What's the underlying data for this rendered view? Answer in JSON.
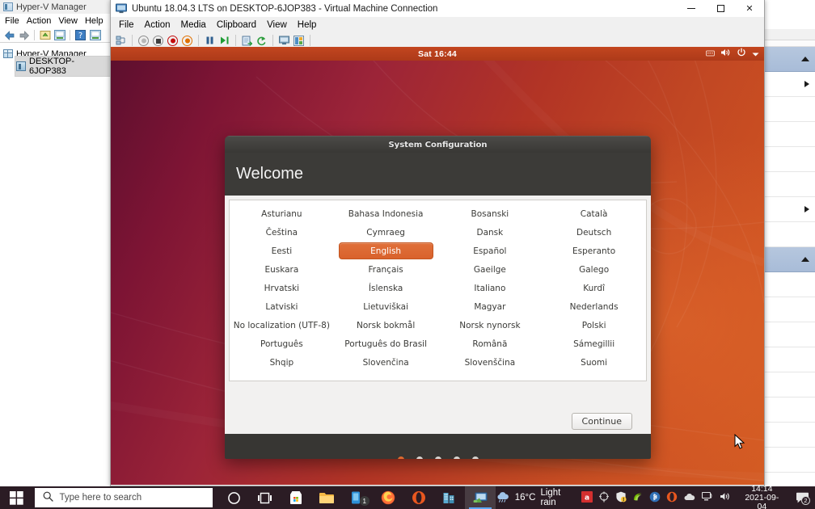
{
  "hyperv_window": {
    "title": "Hyper-V Manager",
    "title_icon": "hyperv-manager-icon",
    "menu": [
      "File",
      "Action",
      "View",
      "Help"
    ],
    "toolbar_icons": [
      "back-arrow-icon",
      "forward-arrow-icon",
      "refresh-icon",
      "properties-icon",
      "help-icon",
      "show-pane-icon"
    ],
    "tree": {
      "root_label": "Hyper-V Manager",
      "child_label": "DESKTOP-6JOP383"
    }
  },
  "vm_window": {
    "title": "Ubuntu 18.04.3 LTS on DESKTOP-6JOP383 - Virtual Machine Connection",
    "title_icon": "virtual-machine-icon",
    "menu": [
      "File",
      "Action",
      "Media",
      "Clipboard",
      "View",
      "Help"
    ],
    "window_buttons": {
      "minimize": "–",
      "maximize": "□",
      "close": "✕"
    },
    "toolbar_icons": [
      "checkpoint-icon",
      "revert-icon",
      "stop-icon",
      "turn-off-icon",
      "shut-down-icon",
      "pause-icon",
      "start-icon",
      "save-icon",
      "reset-icon",
      "enhanced-session-icon",
      "settings-icon"
    ]
  },
  "ubuntu": {
    "topbar": {
      "clock": "Sat 16:44",
      "right_icons": [
        "keyboard-indicator-icon",
        "volume-icon",
        "power-icon",
        "chevron-down-icon"
      ]
    },
    "dialog": {
      "titlebar": "System Configuration",
      "heading": "Welcome",
      "languages": [
        "Asturianu",
        "Bahasa Indonesia",
        "Bosanski",
        "Català",
        "Čeština",
        "Cymraeg",
        "Dansk",
        "Deutsch",
        "Eesti",
        "English",
        "Español",
        "Esperanto",
        "Euskara",
        "Français",
        "Gaeilge",
        "Galego",
        "Hrvatski",
        "Íslenska",
        "Italiano",
        "Kurdî",
        "Latviski",
        "Lietuviškai",
        "Magyar",
        "Nederlands",
        "No localization (UTF-8)",
        "Norsk bokmål",
        "Norsk nynorsk",
        "Polski",
        "Português",
        "Português do Brasil",
        "Română",
        "Sámegillii",
        "Shqip",
        "Slovenčina",
        "Slovenščina",
        "Suomi"
      ],
      "selected_language": "English",
      "continue_label": "Continue",
      "pagination": {
        "total": 5,
        "active_index": 0
      },
      "accent_color": "#dd6a2f"
    }
  },
  "taskbar": {
    "start_icon": "windows-start-icon",
    "search_placeholder": "Type here to search",
    "search_icon": "search-icon",
    "apps": [
      {
        "name": "cortana-icon"
      },
      {
        "name": "task-view-icon"
      },
      {
        "name": "microsoft-store-icon"
      },
      {
        "name": "file-explorer-icon"
      },
      {
        "name": "microsoft-teams-icon",
        "badge": "1"
      },
      {
        "name": "firefox-icon"
      },
      {
        "name": "opera-icon"
      },
      {
        "name": "hyper-v-manager-icon"
      },
      {
        "name": "virtual-machine-connection-icon",
        "active": true
      }
    ],
    "weather": {
      "icon": "cloud-rain-icon",
      "temperature": "16°C",
      "condition": "Light rain"
    },
    "tray_icons": [
      "adobe-icon",
      "snipping-tool-icon",
      "security-warning-icon",
      "nvidia-icon",
      "bluetooth-icon",
      "opera-tray-icon",
      "onedrive-icon",
      "network-icon",
      "volume-icon"
    ],
    "clock": {
      "time": "14:14",
      "date": "2021-09-04"
    },
    "notification": {
      "icon": "action-center-icon",
      "count": "2"
    }
  }
}
